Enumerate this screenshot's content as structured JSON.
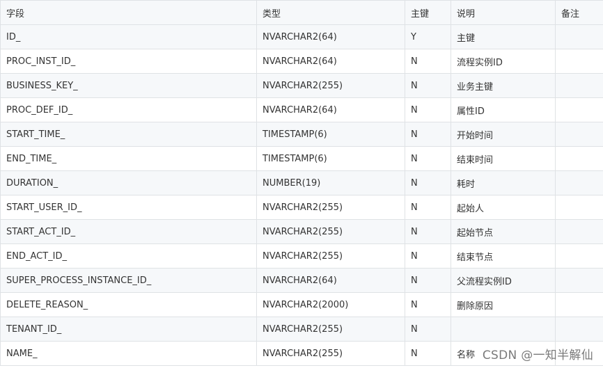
{
  "table": {
    "headers": [
      "字段",
      "类型",
      "主键",
      "说明",
      "备注"
    ],
    "rows": [
      [
        "ID_",
        "NVARCHAR2(64)",
        "Y",
        "主键",
        ""
      ],
      [
        "PROC_INST_ID_",
        "NVARCHAR2(64)",
        "N",
        "流程实例ID",
        ""
      ],
      [
        "BUSINESS_KEY_",
        "NVARCHAR2(255)",
        "N",
        "业务主键",
        ""
      ],
      [
        "PROC_DEF_ID_",
        "NVARCHAR2(64)",
        "N",
        "属性ID",
        ""
      ],
      [
        "START_TIME_",
        "TIMESTAMP(6)",
        "N",
        "开始时间",
        ""
      ],
      [
        "END_TIME_",
        "TIMESTAMP(6)",
        "N",
        "结束时间",
        ""
      ],
      [
        "DURATION_",
        "NUMBER(19)",
        "N",
        "耗时",
        ""
      ],
      [
        "START_USER_ID_",
        "NVARCHAR2(255)",
        "N",
        "起始人",
        ""
      ],
      [
        "START_ACT_ID_",
        "NVARCHAR2(255)",
        "N",
        "起始节点",
        ""
      ],
      [
        "END_ACT_ID_",
        "NVARCHAR2(255)",
        "N",
        "结束节点",
        ""
      ],
      [
        "SUPER_PROCESS_INSTANCE_ID_",
        "NVARCHAR2(64)",
        "N",
        "父流程实例ID",
        ""
      ],
      [
        "DELETE_REASON_",
        "NVARCHAR2(2000)",
        "N",
        "删除原因",
        ""
      ],
      [
        "TENANT_ID_",
        "NVARCHAR2(255)",
        "N",
        "",
        ""
      ],
      [
        "NAME_",
        "NVARCHAR2(255)",
        "N",
        "名称",
        ""
      ]
    ]
  },
  "watermark": "CSDN @一知半解仙"
}
